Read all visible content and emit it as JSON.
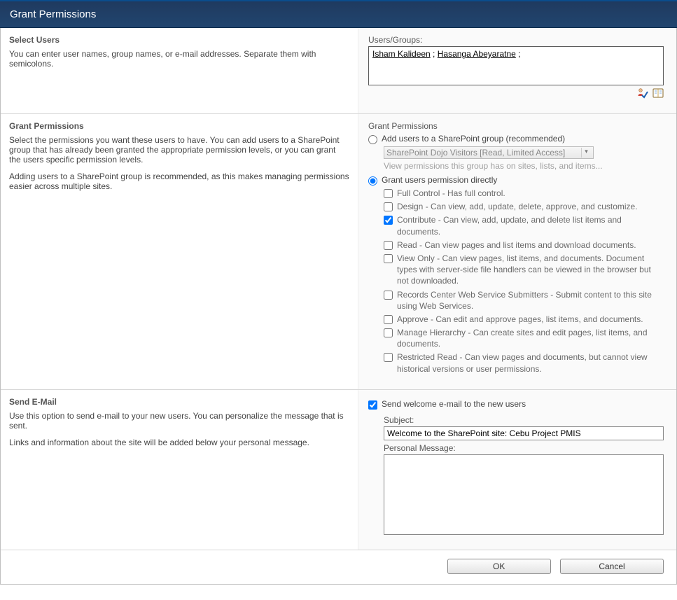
{
  "header": {
    "title": "Grant Permissions"
  },
  "selectUsers": {
    "title": "Select Users",
    "desc": "You can enter user names, group names, or e-mail addresses. Separate them with semicolons.",
    "fieldLabel": "Users/Groups:",
    "entries": [
      "Isham Kalideen",
      "Hasanga Abeyaratne"
    ]
  },
  "grant": {
    "title": "Grant Permissions",
    "desc1": "Select the permissions you want these users to have. You can add users to a SharePoint group that has already been granted the appropriate permission levels, or you can grant the users specific permission levels.",
    "desc2": "Adding users to a SharePoint group is recommended, as this makes managing permissions easier across multiple sites.",
    "rightTitle": "Grant Permissions",
    "radioGroupLabel": "Add users to a SharePoint group (recommended)",
    "groupSelected": "SharePoint Dojo Visitors [Read, Limited Access]",
    "groupNote": "View permissions this group has on sites, lists, and items...",
    "radioDirectLabel": "Grant users permission directly",
    "perms": [
      {
        "chk": false,
        "text": "Full Control - Has full control."
      },
      {
        "chk": false,
        "text": "Design - Can view, add, update, delete, approve, and customize."
      },
      {
        "chk": true,
        "text": "Contribute - Can view, add, update, and delete list items and documents."
      },
      {
        "chk": false,
        "text": "Read - Can view pages and list items and download documents."
      },
      {
        "chk": false,
        "text": "View Only - Can view pages, list items, and documents. Document types with server-side file handlers can be viewed in the browser but not downloaded."
      },
      {
        "chk": false,
        "text": "Records Center Web Service Submitters - Submit content to this site using Web Services."
      },
      {
        "chk": false,
        "text": "Approve - Can edit and approve pages, list items, and documents."
      },
      {
        "chk": false,
        "text": "Manage Hierarchy - Can create sites and edit pages, list items, and documents."
      },
      {
        "chk": false,
        "text": "Restricted Read - Can view pages and documents, but cannot view historical versions or user permissions."
      }
    ]
  },
  "email": {
    "title": "Send E-Mail",
    "desc1": "Use this option to send e-mail to your new users. You can personalize the message that is sent.",
    "desc2": "Links and information about the site will be added below your personal message.",
    "welcomeChk": true,
    "welcomeLabel": "Send welcome e-mail to the new users",
    "subjectLabel": "Subject:",
    "subjectValue": "Welcome to the SharePoint site: Cebu Project PMIS",
    "msgLabel": "Personal Message:",
    "msgValue": ""
  },
  "buttons": {
    "ok": "OK",
    "cancel": "Cancel"
  }
}
